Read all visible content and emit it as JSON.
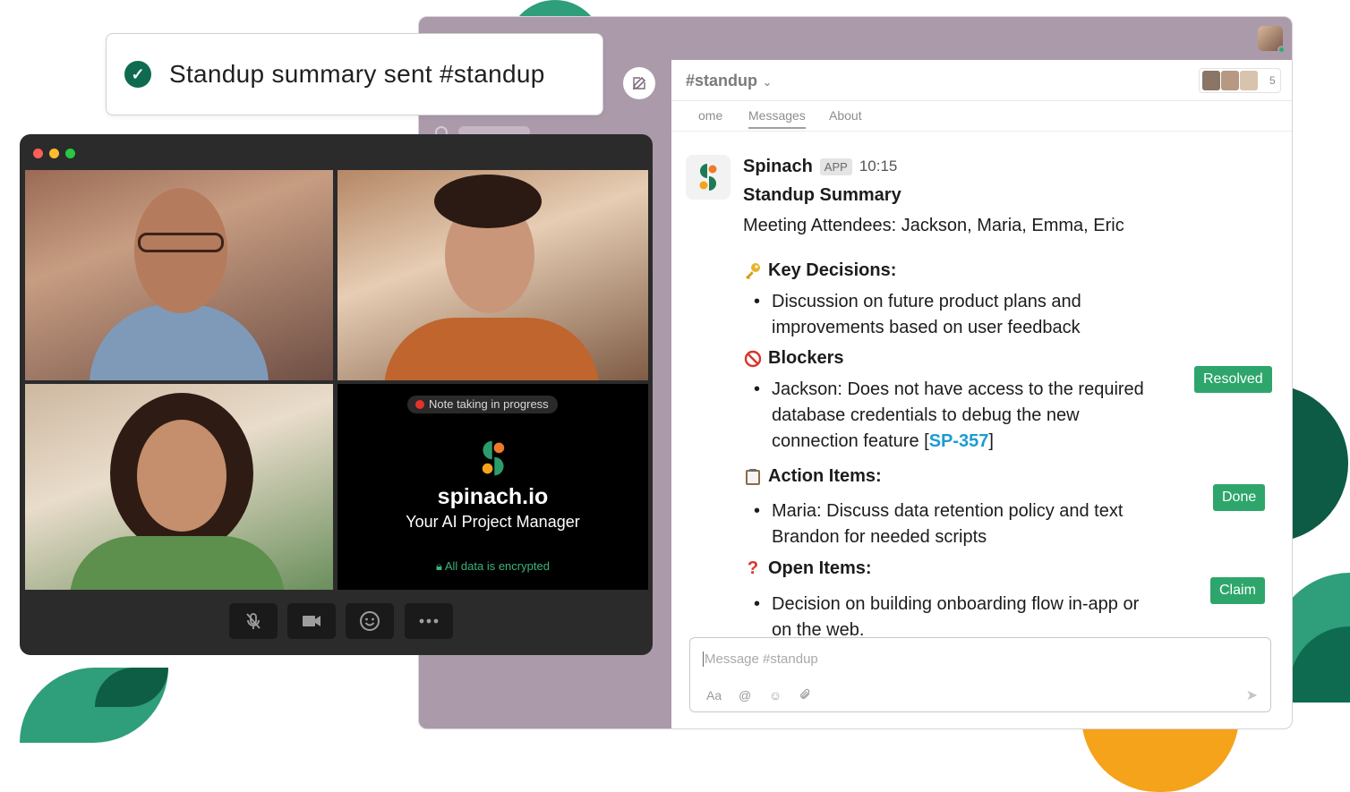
{
  "toast": {
    "text": "Standup summary sent #standup"
  },
  "slack": {
    "channel": "#standup",
    "member_count": "5",
    "tabs": [
      "ome",
      "Messages",
      "About"
    ],
    "message": {
      "sender": "Spinach",
      "badge": "APP",
      "time": "10:15",
      "title": "Standup Summary",
      "attendees": "Meeting Attendees: Jackson, Maria, Emma, Eric",
      "sections": [
        {
          "icon": "key-icon",
          "heading": "Key Decisions:"
        },
        {
          "icon": "no-entry-icon",
          "heading": "Blockers"
        },
        {
          "icon": "clipboard-icon",
          "heading": "Action Items:"
        },
        {
          "icon": "question-icon",
          "heading": "Open Items:"
        }
      ],
      "key_decision": "Discussion on future product plans and improvements based on user feedback",
      "blocker_text": "Jackson: Does not have access to the required database credentials to debug the new connection feature [",
      "blocker_link": "SP-357",
      "blocker_end": "]",
      "blocker_status": "Resolved",
      "action_text": "Maria: Discuss data retention policy and text Brandon for needed scripts",
      "action_status": "Done",
      "open_text": "Decision on building onboarding flow in-app or on the web.",
      "open_status": "Claim"
    },
    "input": {
      "placeholder": "Message #standup",
      "format_label": "Aa"
    }
  },
  "video": {
    "note_pill": "Note taking in progress",
    "brand": "spinach.io",
    "tagline": "Your AI Project Manager",
    "encrypted": "All data is encrypted",
    "controls": [
      "mute-mic-icon",
      "camera-icon",
      "emoji-icon",
      "more-icon"
    ]
  },
  "colors": {
    "brand_green": "#0e5e45",
    "accent_green": "#2f9e7a",
    "accent_orange": "#f5a31a",
    "status_green": "#2ea66b",
    "link_blue": "#1d9bd1",
    "slack_aubergine": "#ab9aaa"
  }
}
